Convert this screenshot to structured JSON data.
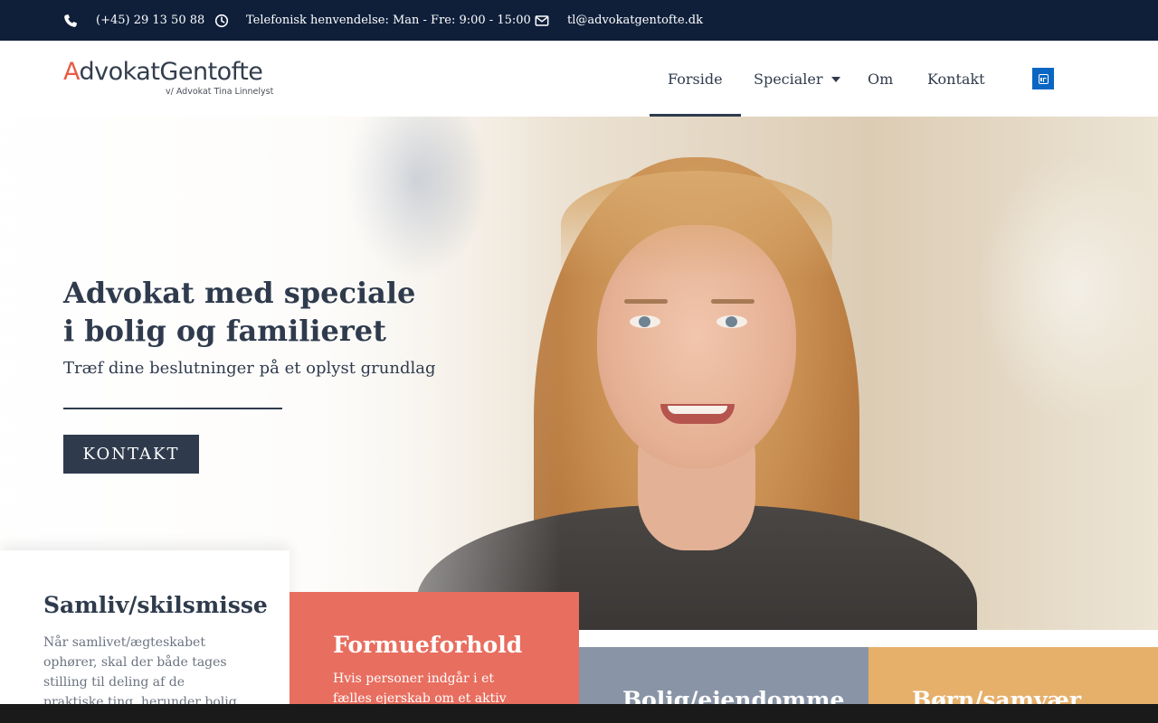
{
  "topbar": {
    "phone": "(+45) 29 13 50 88",
    "hours": "Telefonisk henvendelse: Man - Fre: 9:00 - 15:00",
    "email": "tl@advokatgentofte.dk",
    "icons": [
      "phone-icon",
      "clock-icon",
      "envelope-icon"
    ]
  },
  "header": {
    "logo_main_a": "A",
    "logo_main_rest": "dvokatGentofte",
    "logo_sub": "v/ Advokat Tina Linnelyst",
    "nav": [
      {
        "label": "Forside",
        "active": true
      },
      {
        "label": "Specialer",
        "has_dropdown": true
      },
      {
        "label": "Om"
      },
      {
        "label": "Kontakt"
      }
    ],
    "social_icon": "linkedin-icon"
  },
  "hero": {
    "title_line1": "Advokat med speciale",
    "title_line2": "i bolig og familieret",
    "subtitle": "Træf dine beslutninger på et oplyst grundlag",
    "button": "KONTAKT"
  },
  "cards": [
    {
      "title": "Samliv/skilsmisse",
      "text": "Når samlivet/ægteskabet ophører, skal der både tages stilling til deling af de praktiske ting, herunder bolig, bil og"
    },
    {
      "title": "Formueforhold",
      "text": "Hvis personer indgår i et fælles ejerskab om et aktiv f.eks. en"
    },
    {
      "title": "Bolig/ejendomme",
      "text": ""
    },
    {
      "title": "Børn/samvær",
      "text": ""
    }
  ],
  "colors": {
    "topbar": "#0f1f3a",
    "primary": "#2f3b4d",
    "accent_coral": "#e86e5f",
    "accent_slate": "#8995a6",
    "accent_sand": "#e6b06b",
    "linkedin": "#0a66c2"
  }
}
